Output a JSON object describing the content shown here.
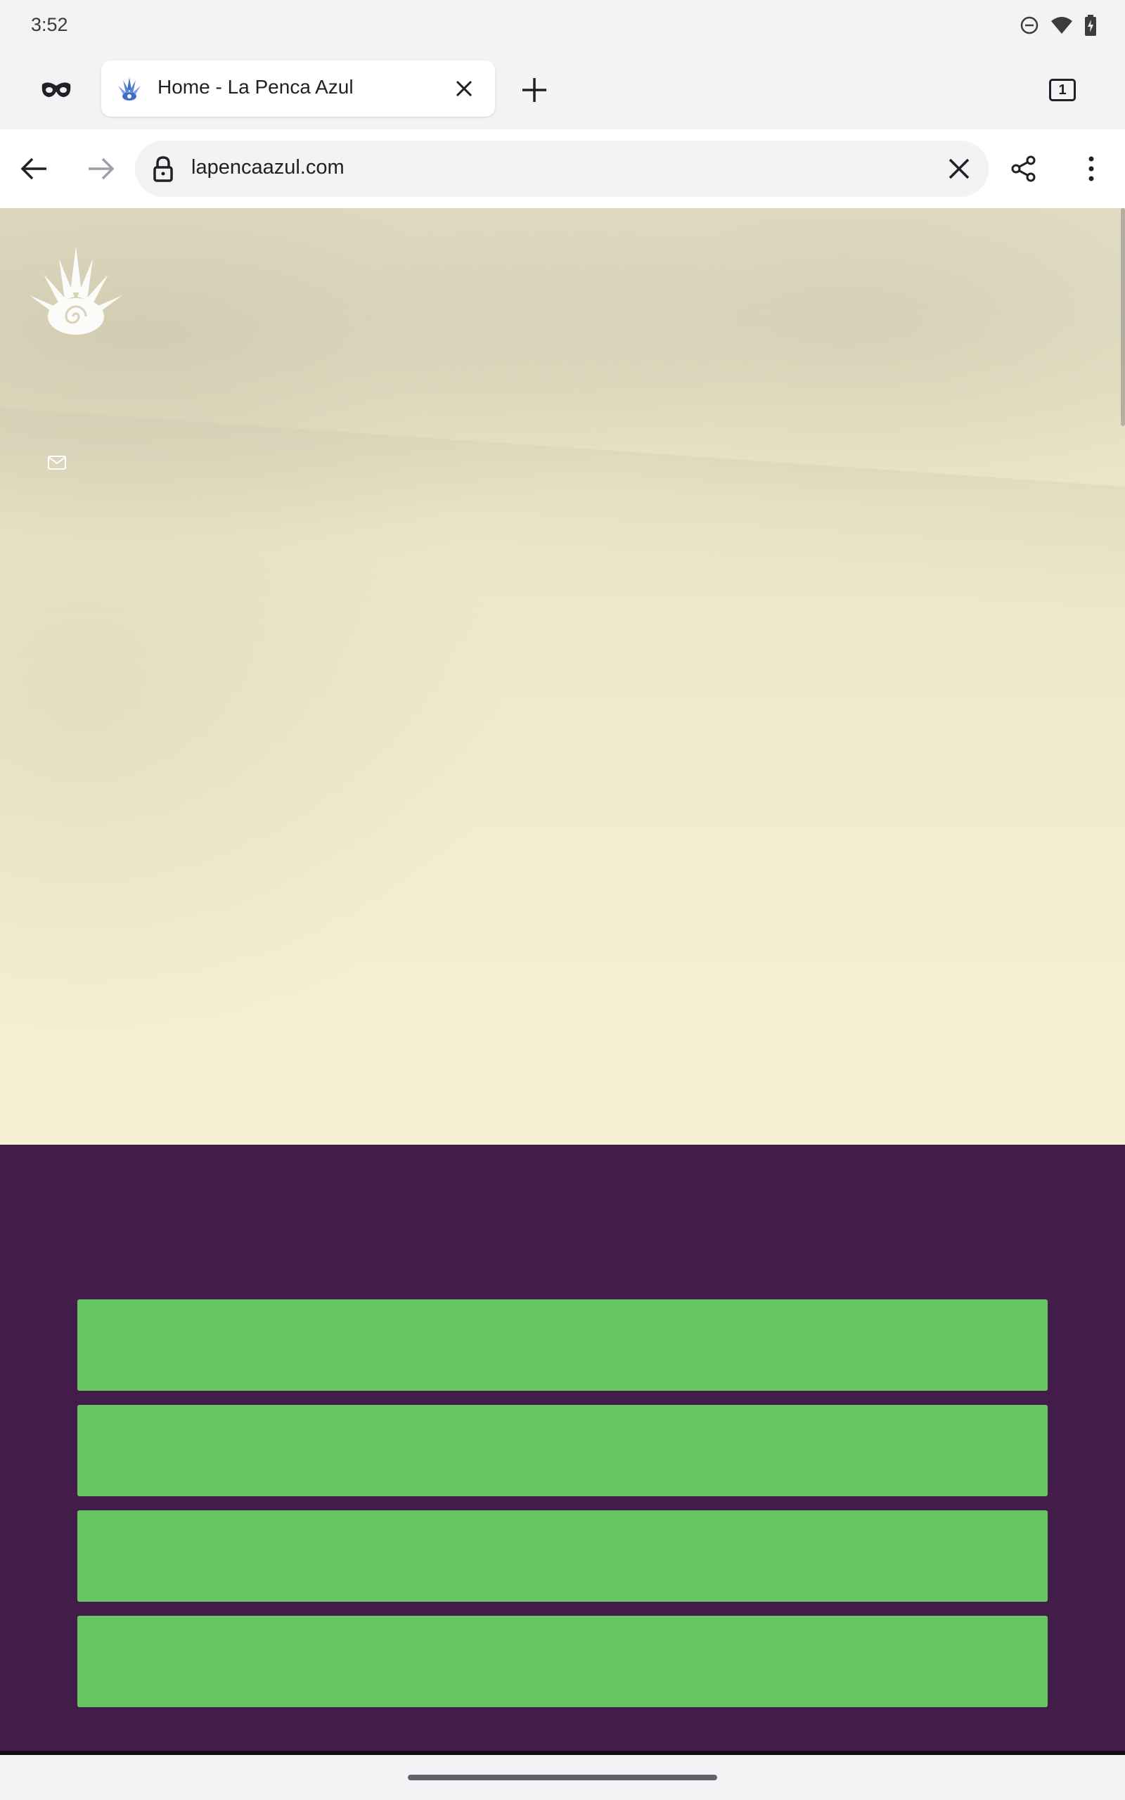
{
  "status_bar": {
    "time": "3:52",
    "icons": [
      "do-not-disturb-icon",
      "wifi-icon",
      "battery-charging-icon"
    ]
  },
  "tab_strip": {
    "active_tab": {
      "title": "Home - La Penca Azul",
      "favicon": "la-penca-azul-favicon"
    },
    "tab_count": "1"
  },
  "toolbar": {
    "url": "lapencaazul.com",
    "icons": [
      "back-arrow-icon",
      "forward-arrow-icon",
      "lock-icon",
      "clear-icon",
      "share-icon",
      "more-vert-icon"
    ]
  },
  "page": {
    "green_buttons": [
      {
        "label": ""
      },
      {
        "label": ""
      },
      {
        "label": ""
      },
      {
        "label": ""
      }
    ]
  },
  "colors": {
    "purple_section": "#441c4a",
    "green_button": "#66c762",
    "hero_background": "#ece6c9"
  }
}
